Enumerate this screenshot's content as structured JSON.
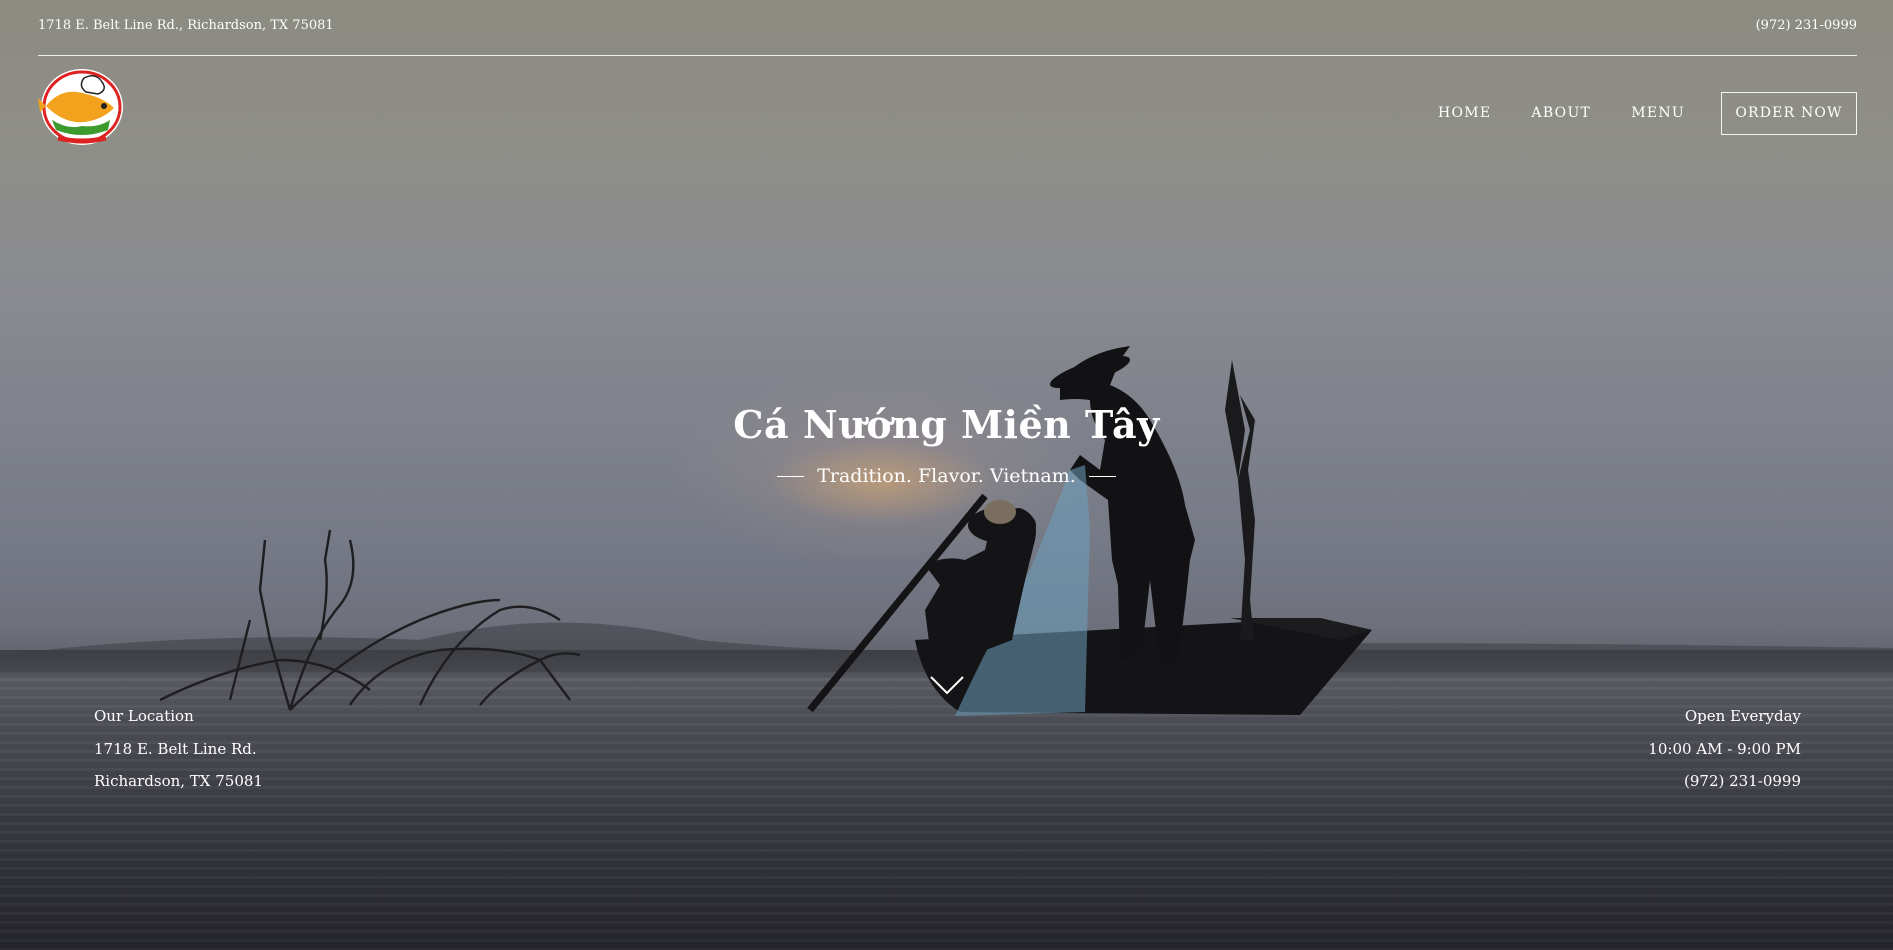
{
  "topbar": {
    "address": "1718 E. Belt Line Rd., Richardson, TX 75081",
    "phone": "(972) 231-0999"
  },
  "logo": {
    "alt": "Cá Nướng Miền Tây logo",
    "icon": "restaurant-logo"
  },
  "nav": {
    "items": [
      {
        "label": "HOME"
      },
      {
        "label": "ABOUT"
      },
      {
        "label": "MENU"
      }
    ],
    "order_label": "ORDER NOW"
  },
  "hero": {
    "title": "Cá Nướng Miền Tây",
    "tagline": "Tradition. Flavor. Vietnam.",
    "scroll_icon": "chevron-down-icon"
  },
  "location": {
    "heading": "Our Location",
    "line1": "1718 E. Belt Line Rd.",
    "line2": "Richardson, TX 75081"
  },
  "hours": {
    "heading": "Open Everyday",
    "time": "10:00 AM - 9:00 PM",
    "phone": "(972) 231-0999"
  },
  "colors": {
    "text": "#ffffff",
    "sky": "#8b8b82",
    "water_dark": "#24252b",
    "sun_glow": "#dcaa6e"
  }
}
